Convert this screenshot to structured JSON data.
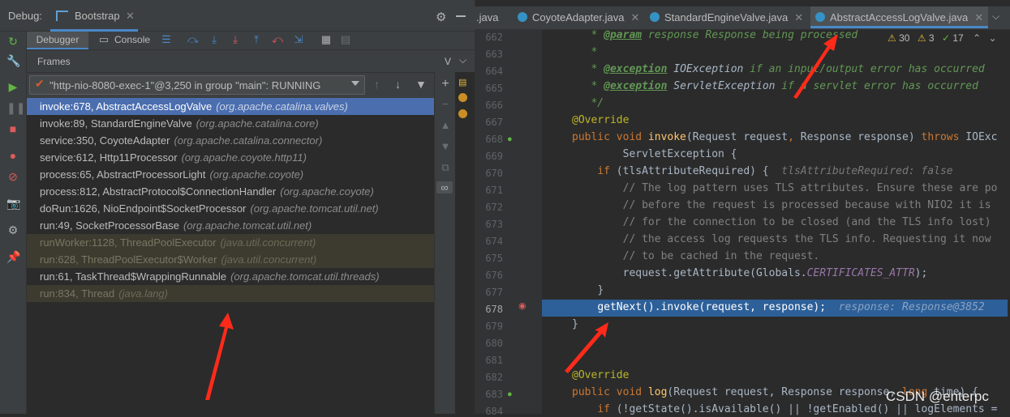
{
  "debug_window": {
    "title": "Debug:",
    "config_tab": "Bootstrap",
    "tabs": [
      "Debugger",
      "Console"
    ],
    "frames_label": "Frames",
    "variables_label": "V",
    "thread": "\"http-nio-8080-exec-1\"@3,250 in group \"main\": RUNNING"
  },
  "frames": [
    {
      "method": "invoke:678, AbstractAccessLogValve",
      "pkg": "(org.apache.catalina.valves)",
      "state": "selected"
    },
    {
      "method": "invoke:89, StandardEngineValve",
      "pkg": "(org.apache.catalina.core)",
      "state": "normal"
    },
    {
      "method": "service:350, CoyoteAdapter",
      "pkg": "(org.apache.catalina.connector)",
      "state": "normal"
    },
    {
      "method": "service:612, Http11Processor",
      "pkg": "(org.apache.coyote.http11)",
      "state": "normal"
    },
    {
      "method": "process:65, AbstractProcessorLight",
      "pkg": "(org.apache.coyote)",
      "state": "normal"
    },
    {
      "method": "process:812, AbstractProtocol$ConnectionHandler",
      "pkg": "(org.apache.coyote)",
      "state": "normal"
    },
    {
      "method": "doRun:1626, NioEndpoint$SocketProcessor",
      "pkg": "(org.apache.tomcat.util.net)",
      "state": "normal"
    },
    {
      "method": "run:49, SocketProcessorBase",
      "pkg": "(org.apache.tomcat.util.net)",
      "state": "normal"
    },
    {
      "method": "runWorker:1128, ThreadPoolExecutor",
      "pkg": "(java.util.concurrent)",
      "state": "library"
    },
    {
      "method": "run:628, ThreadPoolExecutor$Worker",
      "pkg": "(java.util.concurrent)",
      "state": "library"
    },
    {
      "method": "run:61, TaskThread$WrappingRunnable",
      "pkg": "(org.apache.tomcat.util.threads)",
      "state": "normal"
    },
    {
      "method": "run:834, Thread",
      "pkg": "(java.lang)",
      "state": "library"
    }
  ],
  "editor": {
    "tabs": [
      {
        "label": ".java",
        "active": false
      },
      {
        "label": "CoyoteAdapter.java",
        "active": false
      },
      {
        "label": "StandardEngineValve.java",
        "active": false
      },
      {
        "label": "AbstractAccessLogValve.java",
        "active": true
      }
    ],
    "inspections": {
      "warnings": "30",
      "weak_warnings": "3",
      "typos": "17"
    },
    "line_numbers": [
      "662",
      "663",
      "664",
      "665",
      "666",
      "667",
      "668",
      "669",
      "670",
      "671",
      "672",
      "673",
      "674",
      "675",
      "676",
      "677",
      "678",
      "679",
      "680",
      "681",
      "682",
      "683",
      "684"
    ],
    "current_line": "678"
  },
  "code": {
    "l662": {
      "star": "* ",
      "tag": "@param",
      "rest": " response Response being processed"
    },
    "l663": {
      "star": "*"
    },
    "l664": {
      "star": "* ",
      "tag": "@exception",
      "type": " IOException",
      "rest": " if an input/output error has occurred"
    },
    "l665": {
      "star": "* ",
      "tag": "@exception",
      "type": " ServletException",
      "rest": " if a servlet error has occurred"
    },
    "l666": {
      "end": "*/"
    },
    "l667": {
      "ann": "@Override"
    },
    "l668": {
      "kw1": "public void ",
      "fn": "invoke",
      "p1": "(Request request",
      "comma": ", ",
      "p2": "Response response) ",
      "kw2": "throws ",
      "p3": "IOExc"
    },
    "l669": {
      "text": "ServletException {"
    },
    "l670": {
      "kw": "if ",
      "text": "(tlsAttributeRequired) {",
      "hint": "tlsAttributeRequired: false"
    },
    "l671": "// The log pattern uses TLS attributes. Ensure these are po",
    "l672": "// before the request is processed because with NIO2 it is",
    "l673": "// for the connection to be closed (and the TLS info lost)",
    "l674": "// the access log requests the TLS info. Requesting it now",
    "l675": "// to be cached in the request.",
    "l676": {
      "text1": "request.getAttribute(Globals.",
      "const": "CERTIFICATES_ATTR",
      "text2": ");"
    },
    "l677": "}",
    "l678": {
      "text": "getNext().invoke(request, response);",
      "hint": "response: Response@3852"
    },
    "l679": "}",
    "l682": {
      "ann": "@Override"
    },
    "l683": {
      "kw1": "public void ",
      "fn": "log",
      "p1": "(Request request, Response response, ",
      "kw2": "long ",
      "p2": "time) {"
    },
    "l684": {
      "kw": "if ",
      "text": "(!getState().isAvailable() || !getEnabled() || logElements ="
    }
  },
  "watermark": "CSDN @enterpc",
  "colors": {
    "selection": "#4b6eaf",
    "exec_line": "#2d6099",
    "arrow": "#ff2a1a"
  }
}
